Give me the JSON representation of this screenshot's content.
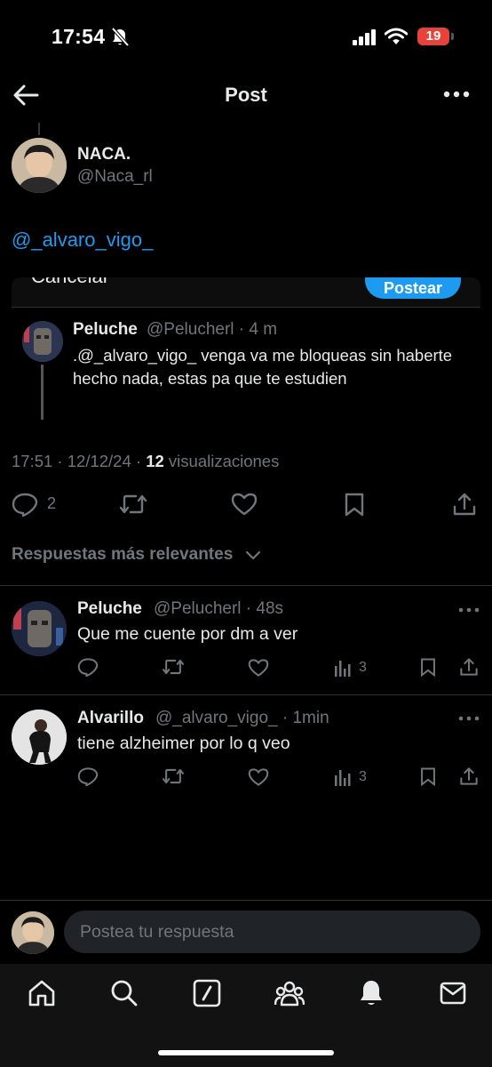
{
  "status_bar": {
    "time": "17:54",
    "battery": "19"
  },
  "header": {
    "title": "Post"
  },
  "post": {
    "author_name": "NACA.",
    "author_handle": "@Naca_rl",
    "text": "@_alvaro_vigo_",
    "timestamp": "17:51 · 12/12/24 · ",
    "views_count": "12",
    "views_label": " visualizaciones",
    "reply_count": "2"
  },
  "embedded": {
    "cancel_label": "Cancelar",
    "post_label": "Postear",
    "name": "Peluche",
    "meta": "@Pelucherl · 4 m",
    "text": ".@_alvaro_vigo_ venga va me bloqueas sin haberte hecho nada, estas pa que te estudien"
  },
  "sort": {
    "label": "Respuestas más relevantes"
  },
  "replies": [
    {
      "name": "Peluche",
      "meta": "@Pelucherl · 48s",
      "text": "Que me cuente por dm a ver",
      "views": "3"
    },
    {
      "name": "Alvarillo",
      "meta": "@_alvaro_vigo_ · 1min",
      "text": "tiene alzheimer por lo q veo",
      "views": "3"
    }
  ],
  "composer": {
    "placeholder": "Postea tu respuesta"
  },
  "colors": {
    "background": "#000000",
    "accent": "#1d9bf0",
    "muted": "#71767b",
    "text": "#e7e9ea",
    "battery": "#e8433a"
  }
}
